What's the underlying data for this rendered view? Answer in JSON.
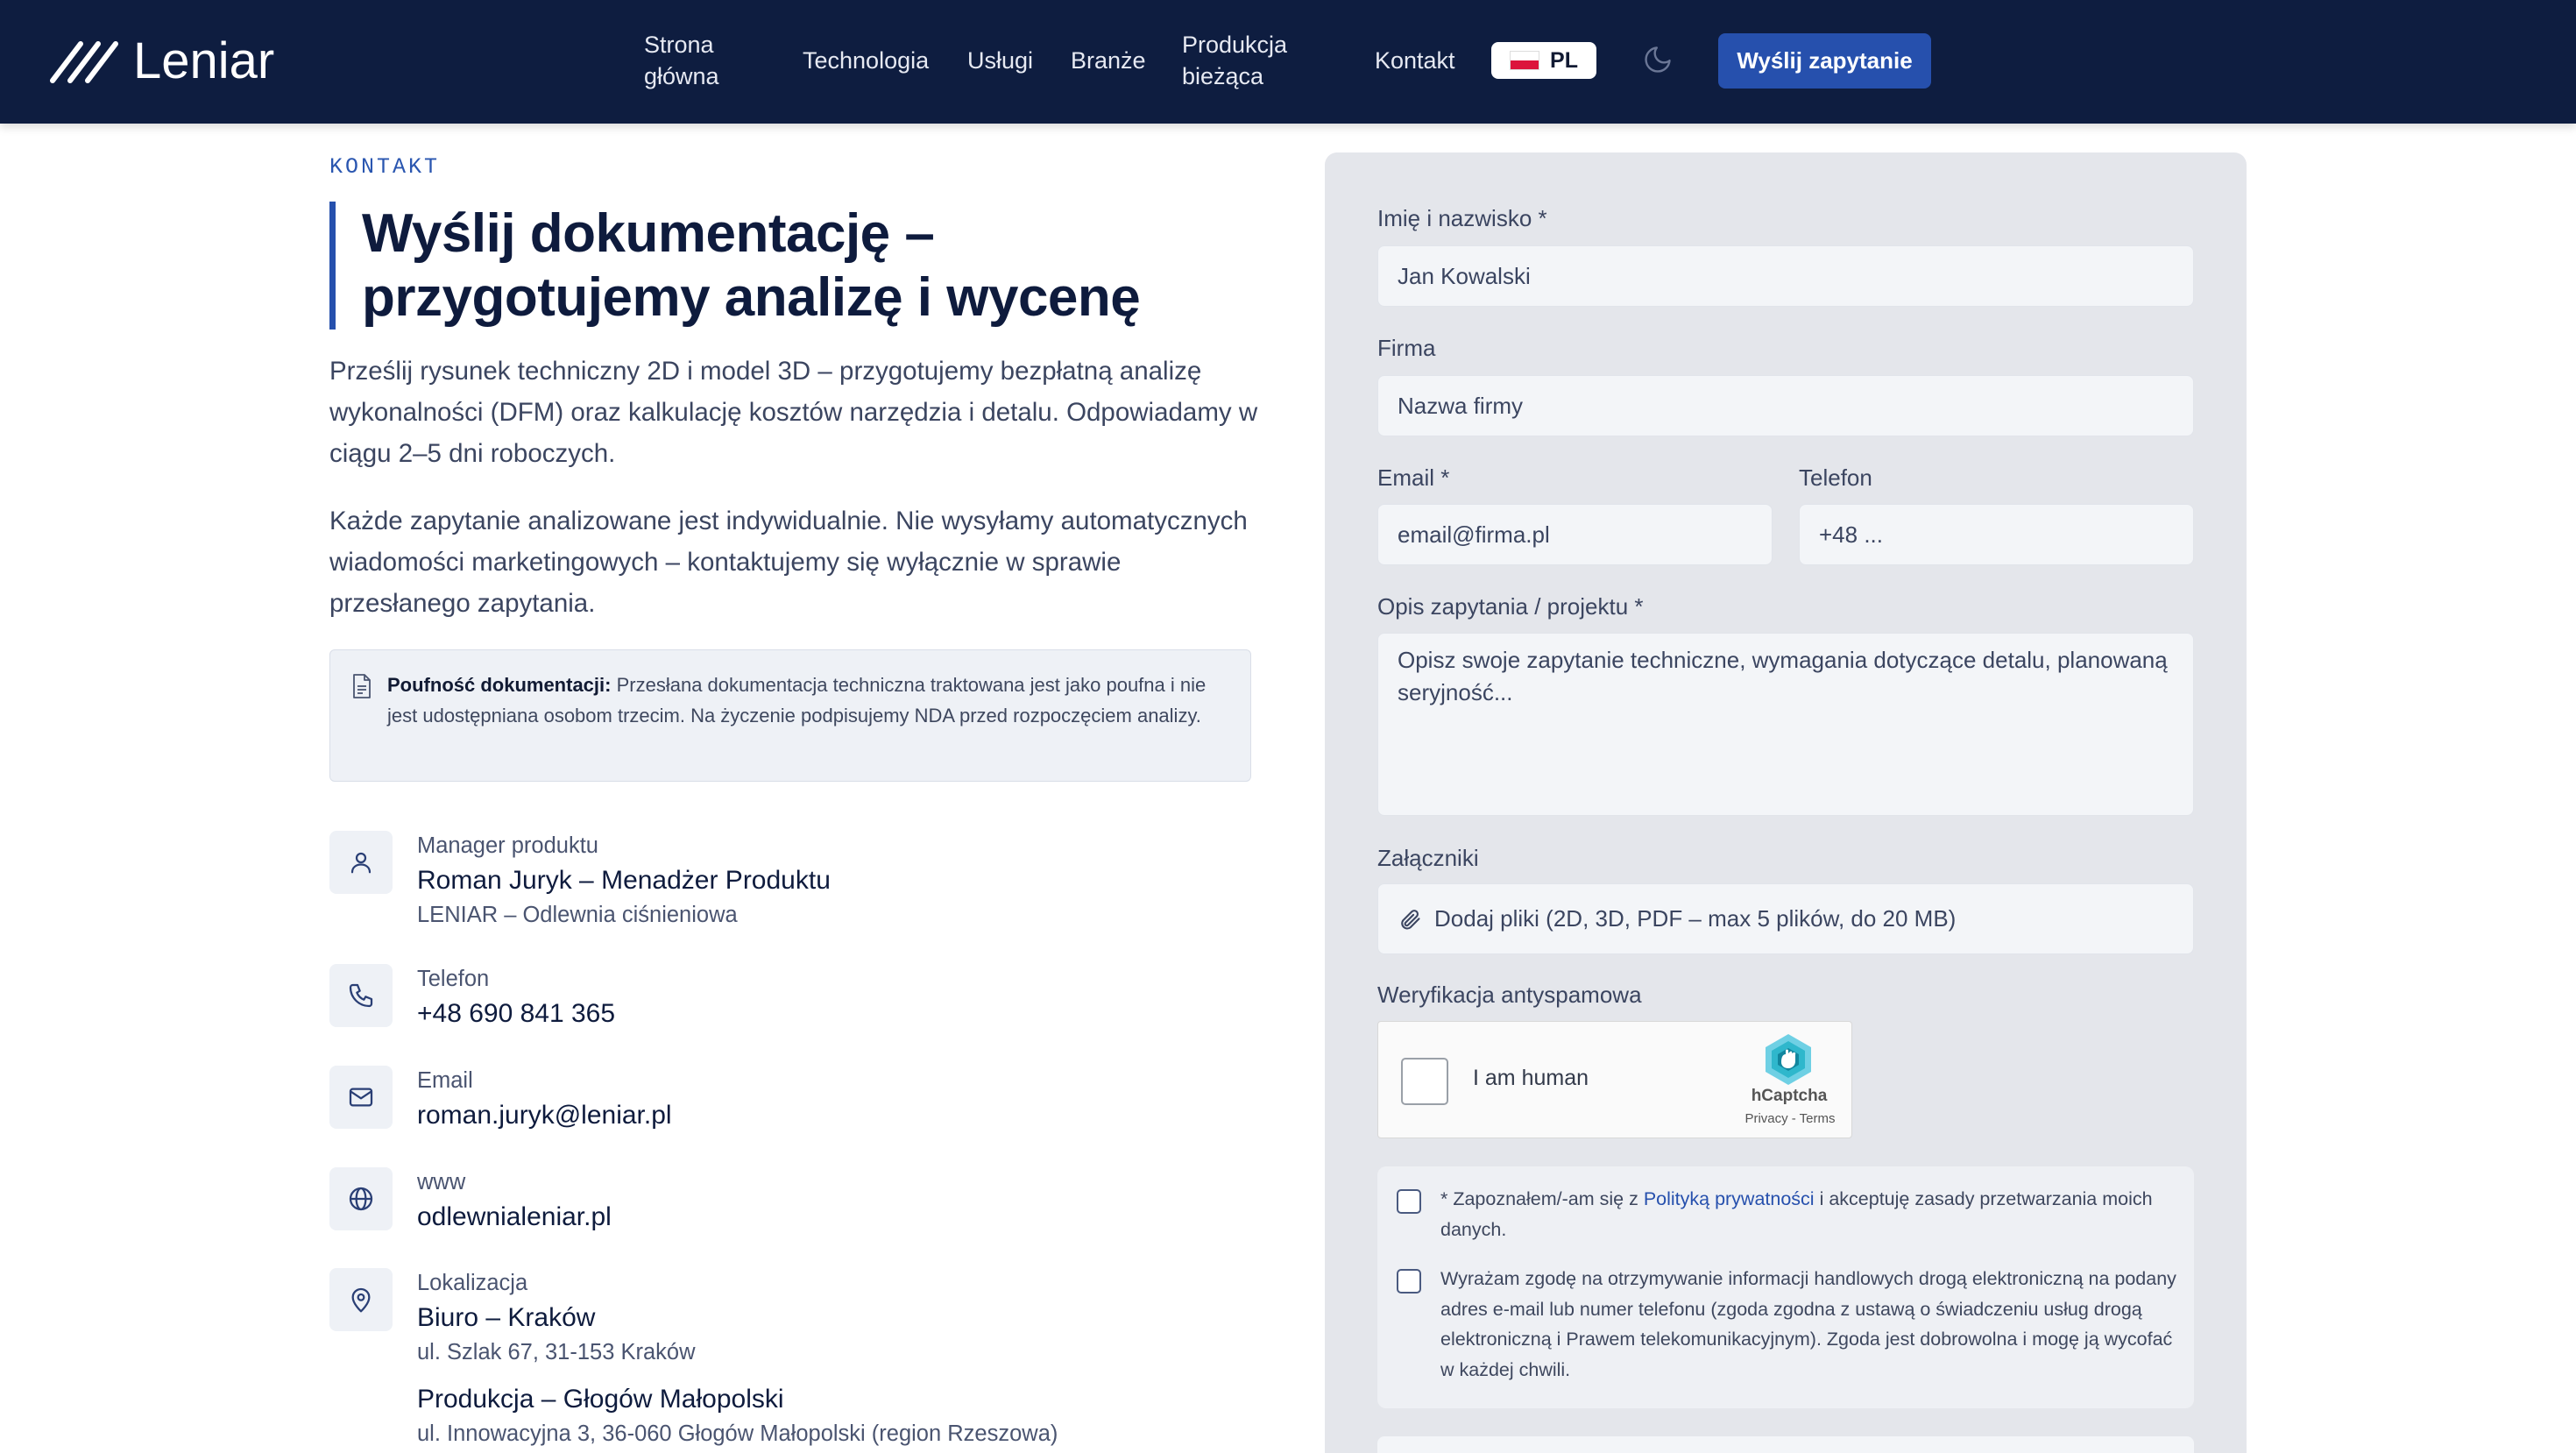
{
  "nav": {
    "logo_text": "Leniar",
    "links": [
      {
        "line1": "Strona",
        "line2": "główna"
      },
      {
        "line1": "Technologia"
      },
      {
        "line1": "Usługi"
      },
      {
        "line1": "Branże"
      },
      {
        "line1": "Produkcja",
        "line2": "bieżąca"
      },
      {
        "line1": "Kontakt"
      }
    ],
    "language": "PL",
    "cta_label": "Wyślij zapytanie"
  },
  "hero": {
    "eyebrow": "KONTAKT",
    "title_line1": "Wyślij dokumentację –",
    "title_line2": "przygotujemy analizę i wycenę",
    "lead1": "Prześlij rysunek techniczny 2D i model 3D – przygotujemy bezpłatną analizę wykonalności (DFM) oraz kalkulację kosztów narzędzia i detalu. Odpowiadamy w ciągu 2–5 dni roboczych.",
    "lead2": "Każde zapytanie analizowane jest indywidualnie. Nie wysyłamy automatycznych wiadomości marketingowych – kontaktujemy się wyłącznie w sprawie przesłanego zapytania.",
    "notice_bold": "Poufność dokumentacji:",
    "notice_text": "Przesłana dokumentacja techniczna traktowana jest jako poufna i nie jest udostępniana osobom trzecim. Na życzenie podpisujemy NDA przed rozpoczęciem analizy."
  },
  "contacts": {
    "manager": {
      "label": "Manager produktu",
      "value": "Roman Juryk – Menadżer Produktu",
      "sub": "LENIAR – Odlewnia ciśnieniowa"
    },
    "phone": {
      "label": "Telefon",
      "value": "+48 690 841 365"
    },
    "email": {
      "label": "Email",
      "value": "roman.juryk@leniar.pl"
    },
    "www": {
      "label": "www",
      "value": "odlewnialeniar.pl"
    },
    "location": {
      "label": "Lokalizacja",
      "office_name": "Biuro – Kraków",
      "office_address": "ul. Szlak 67, 31-153 Kraków",
      "plant_name": "Produkcja – Głogów Małopolski",
      "plant_address": "ul. Innowacyjna 3, 36-060 Głogów Małopolski (region Rzeszowa)"
    }
  },
  "form": {
    "name_label": "Imię i nazwisko *",
    "name_placeholder": "Jan Kowalski",
    "company_label": "Firma",
    "company_placeholder": "Nazwa firmy",
    "email_label": "Email *",
    "email_placeholder": "email@firma.pl",
    "phone_label": "Telefon",
    "phone_placeholder": "+48 ...",
    "desc_label": "Opis zapytania / projektu *",
    "desc_placeholder": "Opisz swoje zapytanie techniczne, wymagania dotyczące detalu, planowaną seryjność...",
    "attach_label": "Załączniki",
    "attach_text": "Dodaj pliki (2D, 3D, PDF – max 5 plików, do 20 MB)",
    "captcha_label": "Weryfikacja antyspamowa",
    "captcha": {
      "text": "I am human",
      "brand": "hCaptcha",
      "links": "Privacy - Terms"
    },
    "consent1_pre": "* Zapoznałem/-am się z ",
    "consent1_link": "Polityką prywatności",
    "consent1_post": " i akceptuję zasady przetwarzania moich danych.",
    "consent2": "Wyrażam zgodę na otrzymywanie informacji handlowych drogą elektroniczną na podany adres e-mail lub numer telefonu (zgoda zgodna z ustawą o świadczeniu usług drogą elektroniczną i Prawem telekomunikacyjnym). Zgoda jest dobrowolna i mogę ją wycofać w każdej chwili."
  },
  "colors": {
    "nav_bg": "#0e1d40",
    "accent": "#2650ad",
    "form_bg": "#e4e6eb"
  }
}
